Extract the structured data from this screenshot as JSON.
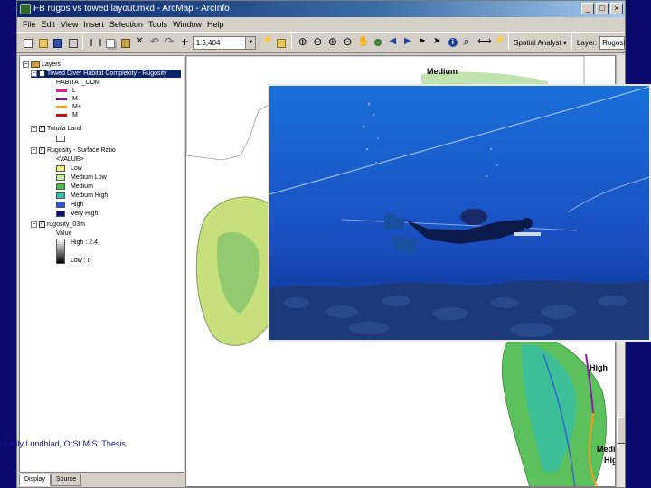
{
  "window": {
    "title": "FB rugos vs towed layout.mxd - ArcMap - ArcInfo",
    "controls": [
      "_",
      "□",
      "×"
    ]
  },
  "menu": [
    "File",
    "Edit",
    "View",
    "Insert",
    "Selection",
    "Tools",
    "Window",
    "Help"
  ],
  "toolbar": {
    "scale_value": "1:5,404",
    "spatial_analyst_label": "Spatial Analyst ▾",
    "layer_label": "Layer:",
    "layer_value": "Rugosi"
  },
  "toc": {
    "root": "Layers",
    "layers": [
      {
        "name": "Towed Diver Habitat Complexity - Rugosity",
        "selected": true,
        "field": "HABITAT_COM",
        "classes": [
          {
            "label": "L",
            "color": "#e02090"
          },
          {
            "label": "M",
            "color": "#8020a0"
          },
          {
            "label": "M+",
            "color": "#f0a020"
          },
          {
            "label": "M",
            "color": "#c01010"
          }
        ]
      },
      {
        "name": "Tutuila Land",
        "field": "",
        "classes": []
      },
      {
        "name": "Rugosity - Surface Ratio",
        "field": "<VALUE>",
        "classes": [
          {
            "label": "Low",
            "color": "#f0f080"
          },
          {
            "label": "Medium Low",
            "color": "#c8f0a0"
          },
          {
            "label": "Medium",
            "color": "#40c040"
          },
          {
            "label": "Medium High",
            "color": "#30c0b0"
          },
          {
            "label": "High",
            "color": "#3050e0"
          },
          {
            "label": "Very High",
            "color": "#101070"
          }
        ]
      },
      {
        "name": "rugosity_03m",
        "field": "Value",
        "high": "High : 2.4",
        "low": "Low : 0"
      }
    ],
    "tabs": [
      "Display",
      "Source"
    ]
  },
  "map": {
    "labels": [
      "Medium",
      "High",
      "Medium",
      "High"
    ],
    "credit": "Emily Lundblad, OrSt M.S. Thesis"
  },
  "colors": {
    "slide_bg": "#0a0a6e",
    "titlebar": "#0a246a",
    "chrome": "#d4d0c8",
    "ocean": "#1a4fc0"
  }
}
